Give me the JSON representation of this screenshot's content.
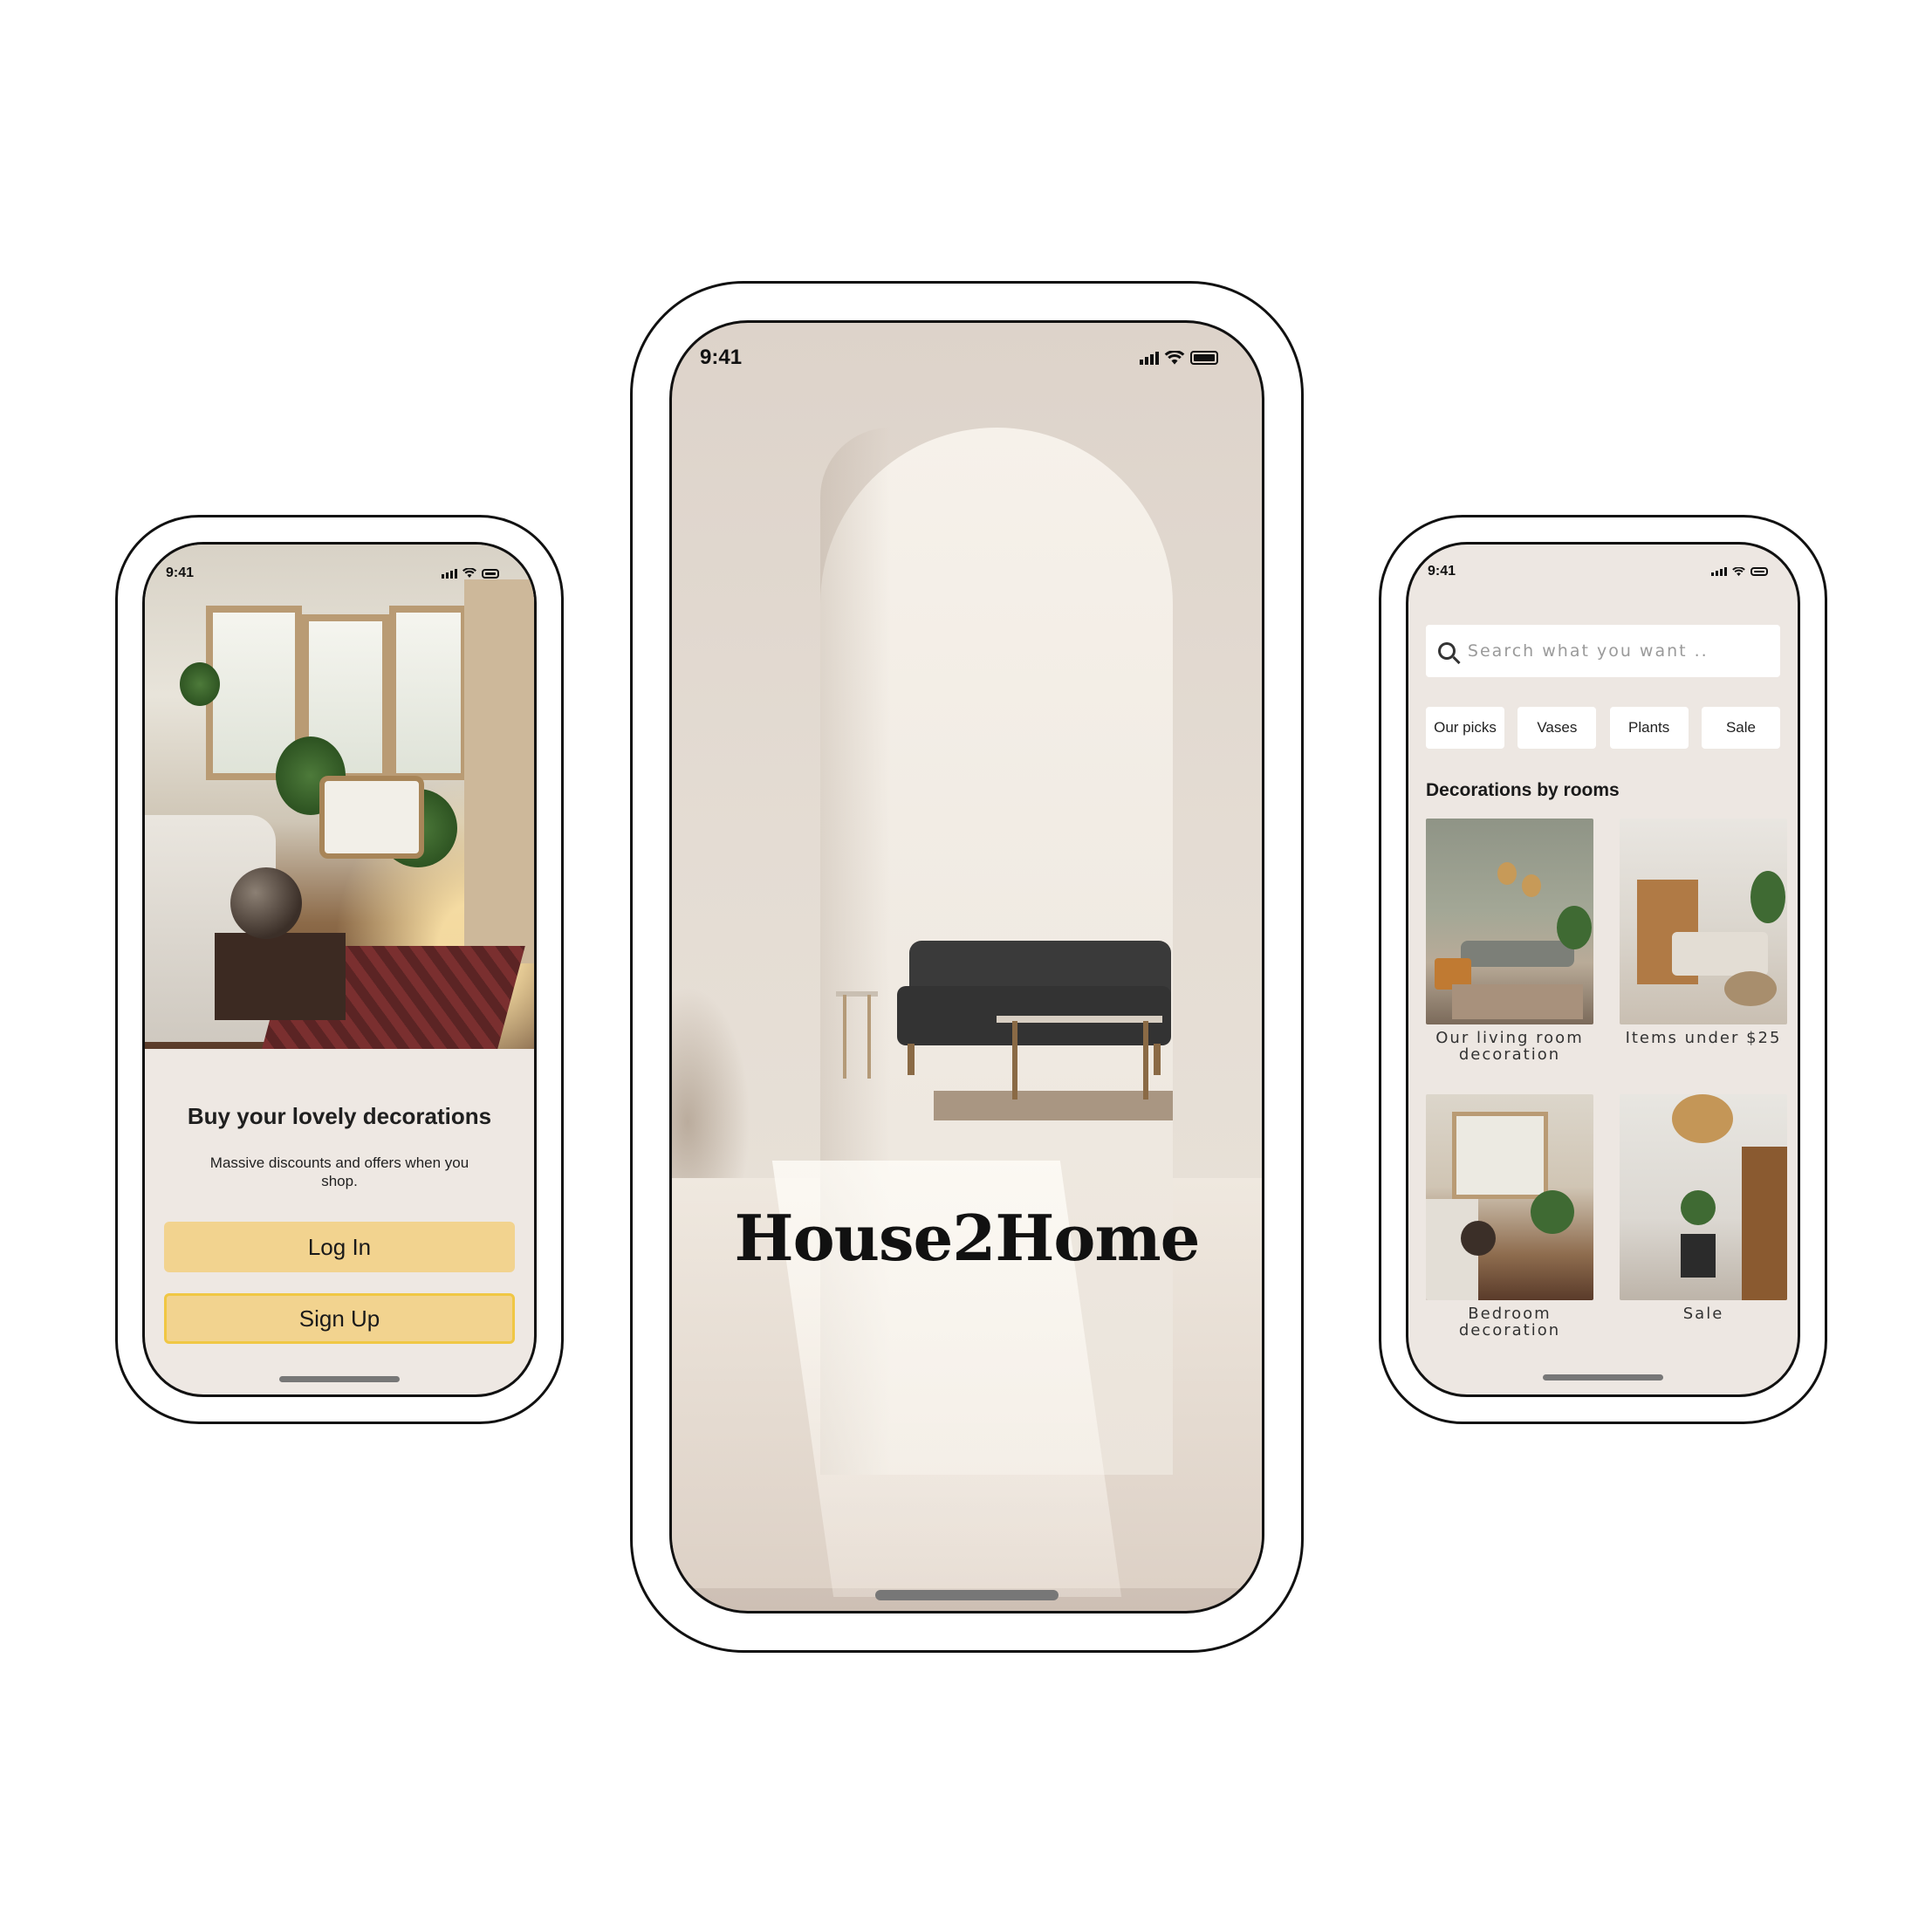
{
  "status_bar": {
    "time": "9:41"
  },
  "left_screen": {
    "title": "Buy your lovely decorations",
    "subtitle": "Massive discounts and offers when you shop.",
    "login_label": "Log In",
    "signup_label": "Sign Up",
    "button_color": "#f2d38f",
    "signup_border_color": "#f0c744"
  },
  "center_screen": {
    "brand": "House2Home"
  },
  "right_screen": {
    "search_placeholder": "Search what you want ..",
    "chips": [
      "Our picks",
      "Vases",
      "Plants",
      "Sale"
    ],
    "section_title": "Decorations by rooms",
    "cards": [
      {
        "caption": "Our living room decoration"
      },
      {
        "caption": "Items under $25"
      },
      {
        "caption": "Bedroom decoration"
      },
      {
        "caption": "Sale"
      }
    ]
  },
  "icons": [
    "signal-icon",
    "wifi-icon",
    "battery-icon",
    "search-icon"
  ]
}
